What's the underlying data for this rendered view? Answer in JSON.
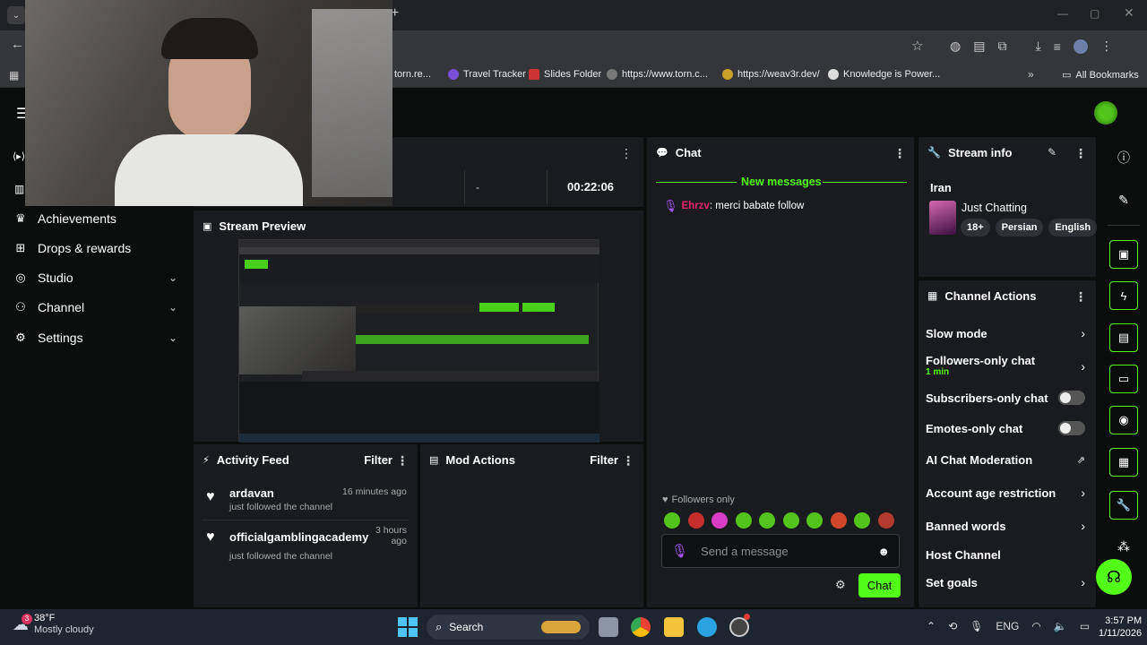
{
  "browser": {
    "bookmarks": [
      "torn.re...",
      "Travel Tracker",
      "Slides Folder",
      "https://www.torn.c...",
      "https://weav3r.dev/",
      "Knowledge is Power...",
      "All Bookmarks"
    ]
  },
  "sidebar": {
    "items": [
      {
        "label": "Achievements",
        "icon": "trophy-icon"
      },
      {
        "label": "Drops & rewards",
        "icon": "gift-icon"
      },
      {
        "label": "Studio",
        "icon": "studio-icon"
      },
      {
        "label": "Channel",
        "icon": "people-icon"
      },
      {
        "label": "Settings",
        "icon": "gear-icon"
      }
    ]
  },
  "stats": {
    "dash": "-",
    "timer": "00:22:06"
  },
  "preview": {
    "title": "Stream Preview"
  },
  "activity": {
    "title": "Activity Feed",
    "filter": "Filter",
    "items": [
      {
        "user": "ardavan",
        "time": "16 minutes ago",
        "text": "just followed the channel"
      },
      {
        "user": "officialgamblingacademy",
        "time": "3 hours ago",
        "text": "just followed the channel"
      }
    ]
  },
  "mod": {
    "title": "Mod Actions",
    "filter": "Filter"
  },
  "chat": {
    "title": "Chat",
    "new_messages": "New messages",
    "messages": [
      {
        "user": "Ehrzv",
        "text": ": merci babate follow"
      }
    ],
    "followers_only": "Followers only",
    "placeholder": "Send a message",
    "send": "Chat"
  },
  "stream_info": {
    "title": "Stream info",
    "name": "Iran",
    "category": "Just Chatting",
    "tags": [
      "18+",
      "Persian",
      "English"
    ]
  },
  "channel_actions": {
    "title": "Channel Actions",
    "items": [
      {
        "label": "Slow mode",
        "control": "chevron"
      },
      {
        "label": "Followers-only chat",
        "sub": "1 min",
        "control": "chevron"
      },
      {
        "label": "Subscribers-only chat",
        "control": "toggle"
      },
      {
        "label": "Emotes-only chat",
        "control": "toggle"
      },
      {
        "label": "AI Chat Moderation",
        "control": "external"
      },
      {
        "label": "Account age restriction",
        "control": "chevron"
      },
      {
        "label": "Banned words",
        "control": "chevron"
      },
      {
        "label": "Host Channel",
        "control": "none"
      },
      {
        "label": "Set goals",
        "control": "chevron"
      }
    ]
  },
  "taskbar": {
    "weather_temp": "38°F",
    "weather_desc": "Mostly cloudy",
    "weather_badge": "3",
    "search": "Search",
    "lang": "ENG",
    "time": "3:57 PM",
    "date": "1/11/2026"
  },
  "colors": {
    "accent": "#53fc18",
    "panel": "#191b1f",
    "bg": "#0b0d0c",
    "username": "#e7256b"
  }
}
